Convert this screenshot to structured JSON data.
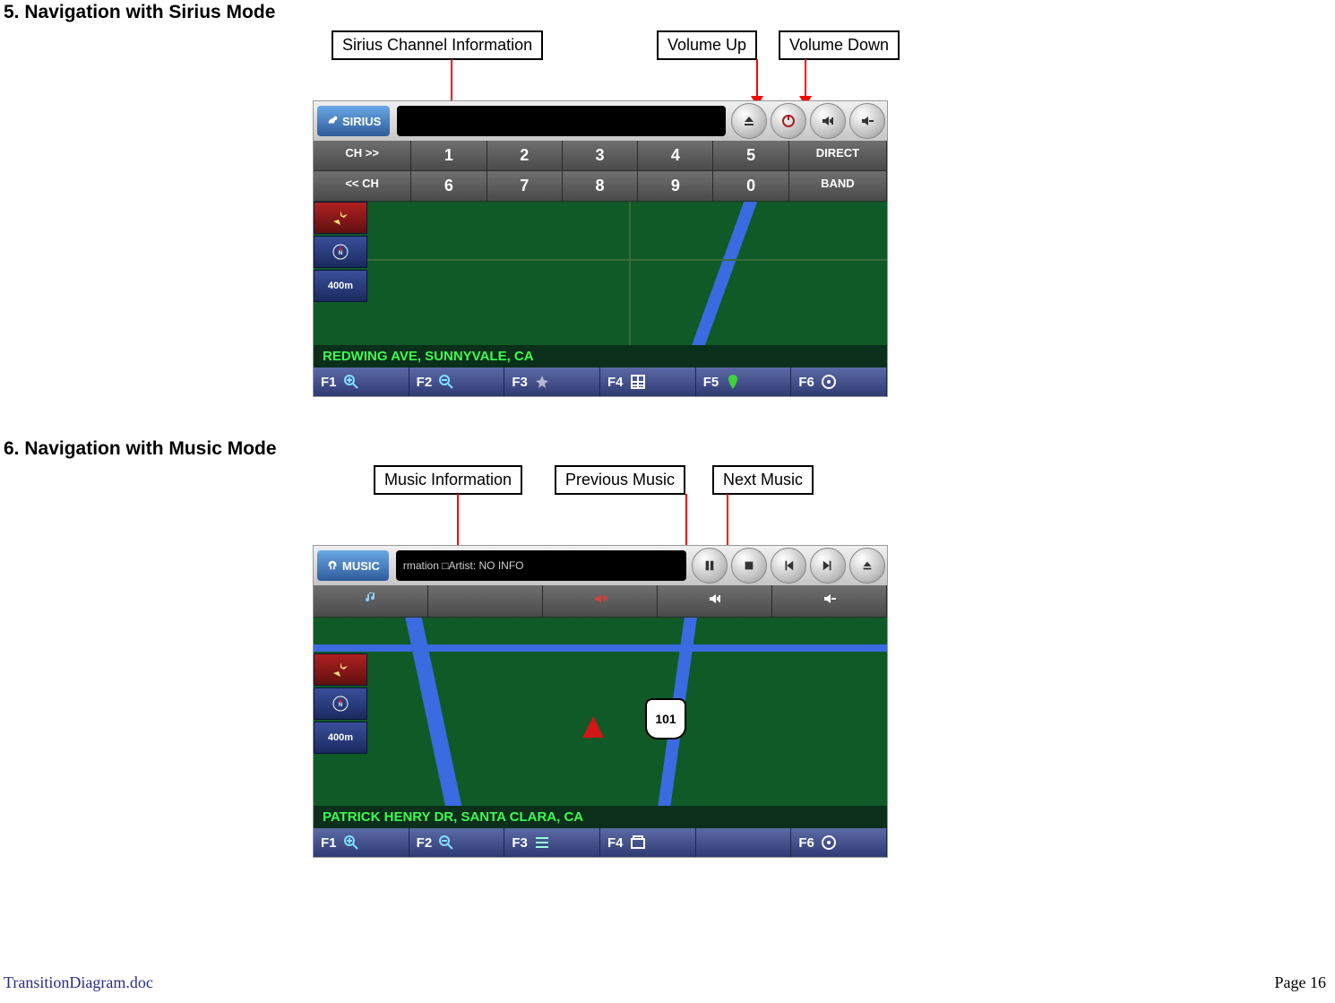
{
  "headings": {
    "sirius": "5. Navigation with Sirius Mode",
    "music": "6. Navigation with Music Mode"
  },
  "callouts": {
    "sirius_info": "Sirius Channel Information",
    "vol_up": "Volume Up",
    "vol_down": "Volume Down",
    "music_info": "Music Information",
    "prev_music": "Previous Music",
    "next_music": "Next Music"
  },
  "sirius": {
    "mode_label": "SIRIUS",
    "info_text": "",
    "row1": {
      "ch_next": "CH >>",
      "n1": "1",
      "n2": "2",
      "n3": "3",
      "n4": "4",
      "n5": "5",
      "direct": "DIRECT"
    },
    "row2": {
      "ch_prev": "<< CH",
      "n6": "6",
      "n7": "7",
      "n8": "8",
      "n9": "9",
      "n0": "0",
      "band": "BAND"
    },
    "scale": "400m",
    "street": "REDWING AVE, SUNNYVALE, CA",
    "fkeys": {
      "f1": "F1",
      "f2": "F2",
      "f3": "F3",
      "f4": "F4",
      "f5": "F5",
      "f6": "F6"
    }
  },
  "music": {
    "mode_label": "MUSIC",
    "info_text": "rmation □Artist: NO INFO",
    "scale": "400m",
    "shield": "101",
    "street": "PATRICK HENRY DR, SANTA CLARA, CA",
    "fkeys": {
      "f1": "F1",
      "f2": "F2",
      "f3": "F3",
      "f4": "F4",
      "f6": "F6"
    }
  },
  "footer": {
    "left": "TransitionDiagram.doc",
    "right": "Page 16"
  }
}
